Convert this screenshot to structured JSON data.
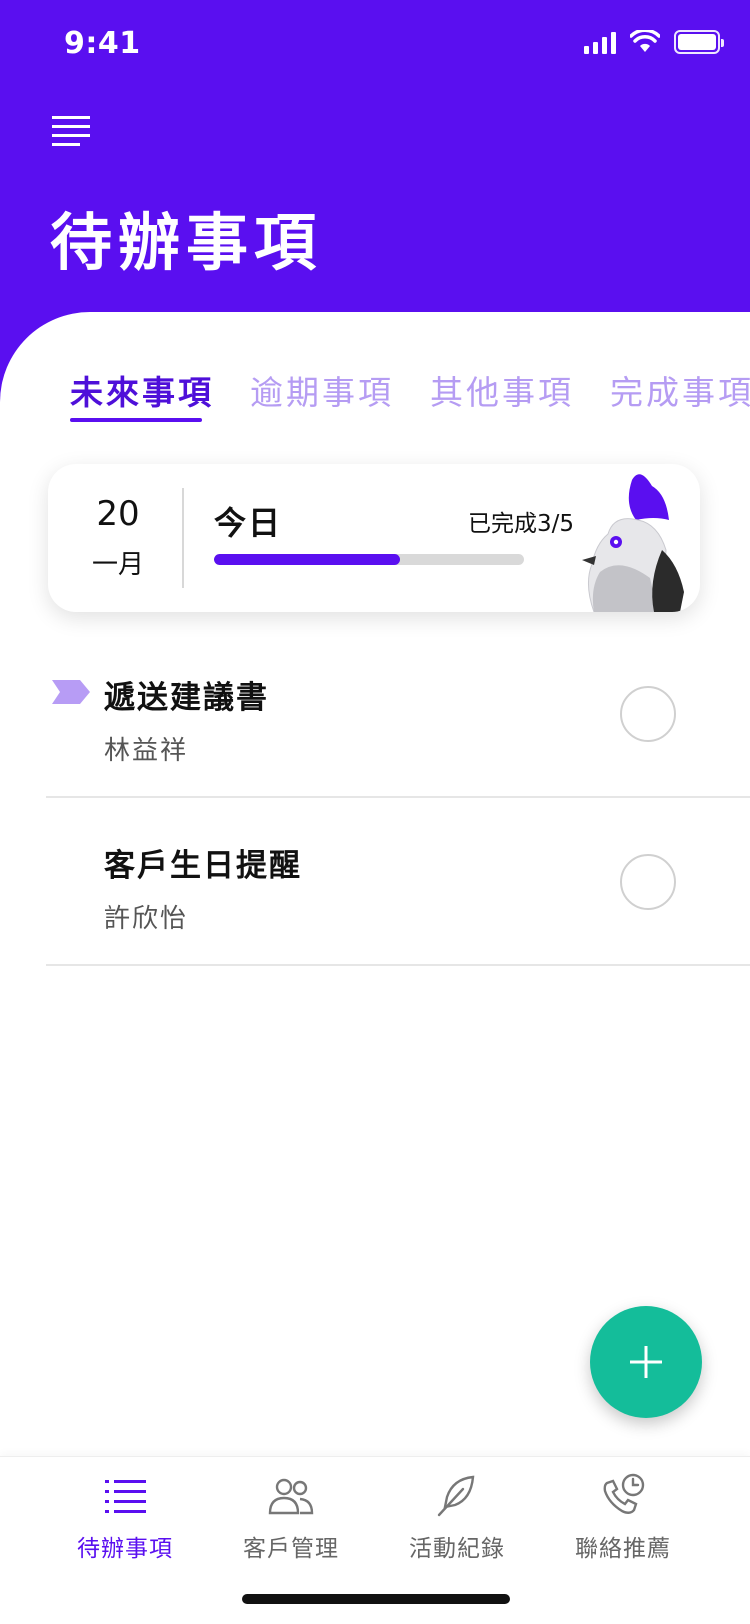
{
  "status_bar": {
    "time": "9:41"
  },
  "header": {
    "title": "待辦事項"
  },
  "tabs": [
    {
      "label": "未來事項",
      "active": true
    },
    {
      "label": "逾期事項",
      "active": false
    },
    {
      "label": "其他事項",
      "active": false
    },
    {
      "label": "完成事項",
      "active": false
    }
  ],
  "summary": {
    "day": "20",
    "month": "一月",
    "today_label": "今日",
    "completed_text": "已完成3/5",
    "progress": 0.6
  },
  "tasks": [
    {
      "title": "遞送建議書",
      "contact": "林益祥",
      "flag_color": "#b79cf5",
      "flagged": true
    },
    {
      "title": "客戶生日提醒",
      "contact": "許欣怡",
      "flagged": false
    }
  ],
  "fab": {
    "icon": "plus-icon"
  },
  "bottom_nav": [
    {
      "label": "待辦事項",
      "icon": "todo-list-icon",
      "active": true
    },
    {
      "label": "客戶管理",
      "icon": "customers-icon",
      "active": false
    },
    {
      "label": "活動紀錄",
      "icon": "feather-pen-icon",
      "active": false
    },
    {
      "label": "聯絡推薦",
      "icon": "phone-clock-icon",
      "active": false
    }
  ],
  "colors": {
    "primary": "#5a0ff0",
    "tab_inactive": "#b59cf3",
    "fab": "#14bd9a",
    "progress_track": "#d9d9d9"
  }
}
